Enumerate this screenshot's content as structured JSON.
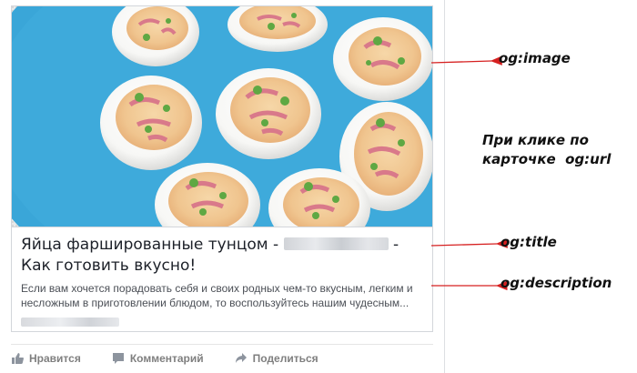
{
  "card": {
    "image_alt": "Фаршированные яйца с тунцом на голубой тарелке",
    "title_before": "Яйца фаршированные тунцом - ",
    "title_after": " - Как готовить вкусно!",
    "description": "Если вам хочется порадовать себя и своих родных чем-то вкусным, легким и несложным в приготовлении блюдом, то воспользуйтесь нашим чудесным..."
  },
  "actions": {
    "like_label": "Нравится",
    "comment_label": "Комментарий",
    "share_label": "Поделиться"
  },
  "annotations": {
    "og_image": "og:image",
    "click_line1": "При клике по",
    "click_line2": "карточке  og:url",
    "og_title": "og:title",
    "og_description": "og:description"
  },
  "colors": {
    "plate_blue": "#3aa6d8",
    "arrow_red": "#d62020",
    "action_gray": "#7f7f7f"
  }
}
